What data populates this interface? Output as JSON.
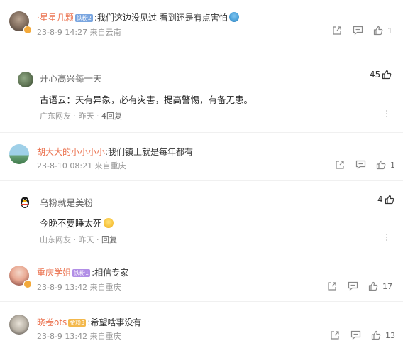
{
  "comments": [
    {
      "user": "·星星几颗",
      "level": "铁粉2",
      "text": ":我们这边没见过 看到还是有点害怕",
      "date": "23-8-9 14:27",
      "loc": "来自云南",
      "likes": "1"
    },
    {
      "user": "胡大大的小小小小",
      "text": ":我们镇上就是每年都有",
      "date": "23-8-10 08:21",
      "loc": "来自重庆",
      "likes": "1"
    },
    {
      "user": "重庆学姐",
      "level": "铁粉1",
      "text": ":相信专家",
      "date": "23-8-9 13:42",
      "loc": "来自重庆",
      "likes": "17"
    },
    {
      "user": "晓卷ots",
      "level": "金粉3",
      "text": ":希望啥事没有",
      "date": "23-8-9 13:42",
      "loc": "来自重庆",
      "likes": "13"
    }
  ],
  "hot": [
    {
      "user": "开心高兴每一天",
      "text": "古语云：天有异象，必有灾害，提高警惕，有备无患。",
      "meta1": "广东网友",
      "meta2": "昨天",
      "meta3": "4回复",
      "likes": "45"
    },
    {
      "user": "乌粉就是美粉",
      "text": "今晚不要睡太死",
      "meta1": "山东网友",
      "meta2": "昨天",
      "meta3": "回复",
      "likes": "4"
    }
  ],
  "sep": "·"
}
